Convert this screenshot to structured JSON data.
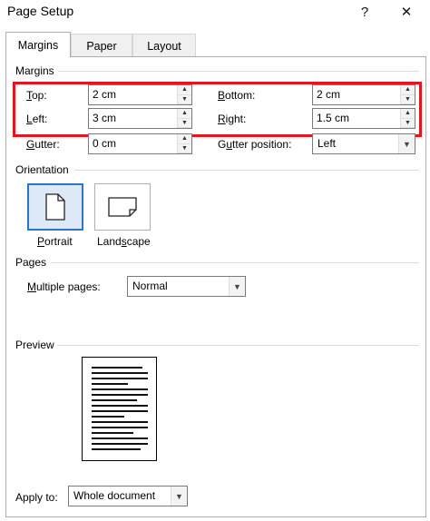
{
  "window": {
    "title": "Page Setup",
    "help_glyph": "?",
    "close_glyph": "✕"
  },
  "tabs": [
    {
      "label": "Margins",
      "active": true
    },
    {
      "label": "Paper",
      "active": false
    },
    {
      "label": "Layout",
      "active": false
    }
  ],
  "margins": {
    "group_label": "Margins",
    "top": {
      "label_u": "T",
      "label_rest": "op:",
      "value": "2 cm"
    },
    "bottom": {
      "label_u": "B",
      "label_rest": "ottom:",
      "value": "2 cm"
    },
    "left": {
      "label_u": "L",
      "label_rest": "eft:",
      "value": "3 cm"
    },
    "right": {
      "label_u": "R",
      "label_rest": "ight:",
      "value": "1.5 cm"
    },
    "gutter": {
      "label_u": "G",
      "label_rest": "utter:",
      "value": "0 cm"
    },
    "gutter_position": {
      "label_pre": "G",
      "label_u": "u",
      "label_rest": "tter position:",
      "value": "Left"
    }
  },
  "orientation": {
    "group_label": "Orientation",
    "portrait": {
      "label_u": "P",
      "label_rest": "ortrait",
      "selected": true
    },
    "landscape": {
      "label_pre": "Land",
      "label_u": "s",
      "label_rest": "cape",
      "selected": false
    }
  },
  "pages": {
    "group_label": "Pages",
    "multiple_pages": {
      "label_u": "M",
      "label_rest": "ultiple pages:",
      "value": "Normal"
    }
  },
  "preview": {
    "group_label": "Preview"
  },
  "apply_to": {
    "label_pre": "Apply to:",
    "value": "Whole document"
  },
  "colors": {
    "highlight": "#e3151e",
    "selected_orientation_border": "#2c74c8"
  }
}
